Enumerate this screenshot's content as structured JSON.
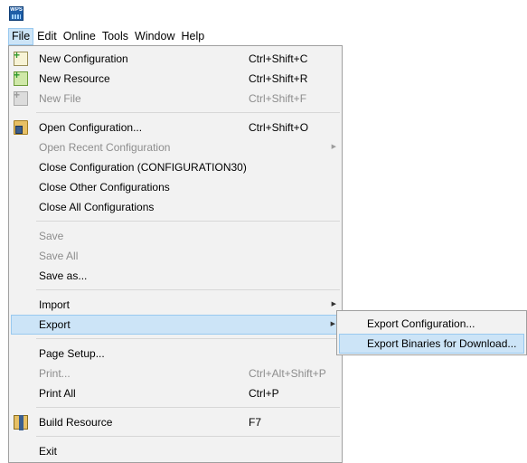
{
  "app": {
    "icon": "wps-app-icon",
    "icon_text": "WPS"
  },
  "menubar": {
    "items": [
      "File",
      "Edit",
      "Online",
      "Tools",
      "Window",
      "Help"
    ]
  },
  "file_menu": {
    "new_configuration": {
      "label": "New Configuration",
      "shortcut": "Ctrl+Shift+C",
      "icon": "new-configuration-icon"
    },
    "new_resource": {
      "label": "New Resource",
      "shortcut": "Ctrl+Shift+R",
      "icon": "new-resource-icon"
    },
    "new_file": {
      "label": "New File",
      "shortcut": "Ctrl+Shift+F",
      "icon": "new-file-icon"
    },
    "open_configuration": {
      "label": "Open Configuration...",
      "shortcut": "Ctrl+Shift+O",
      "icon": "open-configuration-icon"
    },
    "open_recent": {
      "label": "Open Recent Configuration"
    },
    "close_configuration": {
      "label": "Close Configuration (CONFIGURATION30)"
    },
    "close_other": {
      "label": "Close Other Configurations"
    },
    "close_all": {
      "label": "Close All Configurations"
    },
    "save": {
      "label": "Save"
    },
    "save_all": {
      "label": "Save All"
    },
    "save_as": {
      "label": "Save as..."
    },
    "import": {
      "label": "Import"
    },
    "export": {
      "label": "Export"
    },
    "page_setup": {
      "label": "Page Setup..."
    },
    "print": {
      "label": "Print...",
      "shortcut": "Ctrl+Alt+Shift+P"
    },
    "print_all": {
      "label": "Print All",
      "shortcut": "Ctrl+P"
    },
    "build_resource": {
      "label": "Build Resource",
      "shortcut": "F7",
      "icon": "build-resource-icon"
    },
    "exit": {
      "label": "Exit"
    }
  },
  "export_submenu": {
    "export_configuration": {
      "label": "Export Configuration..."
    },
    "export_binaries": {
      "label": "Export Binaries for Download..."
    }
  },
  "colors": {
    "menu_background": "#f2f2f2",
    "highlight": "#cce4f7",
    "highlight_border": "#99c9ef",
    "disabled_text": "#8d8d8d"
  }
}
